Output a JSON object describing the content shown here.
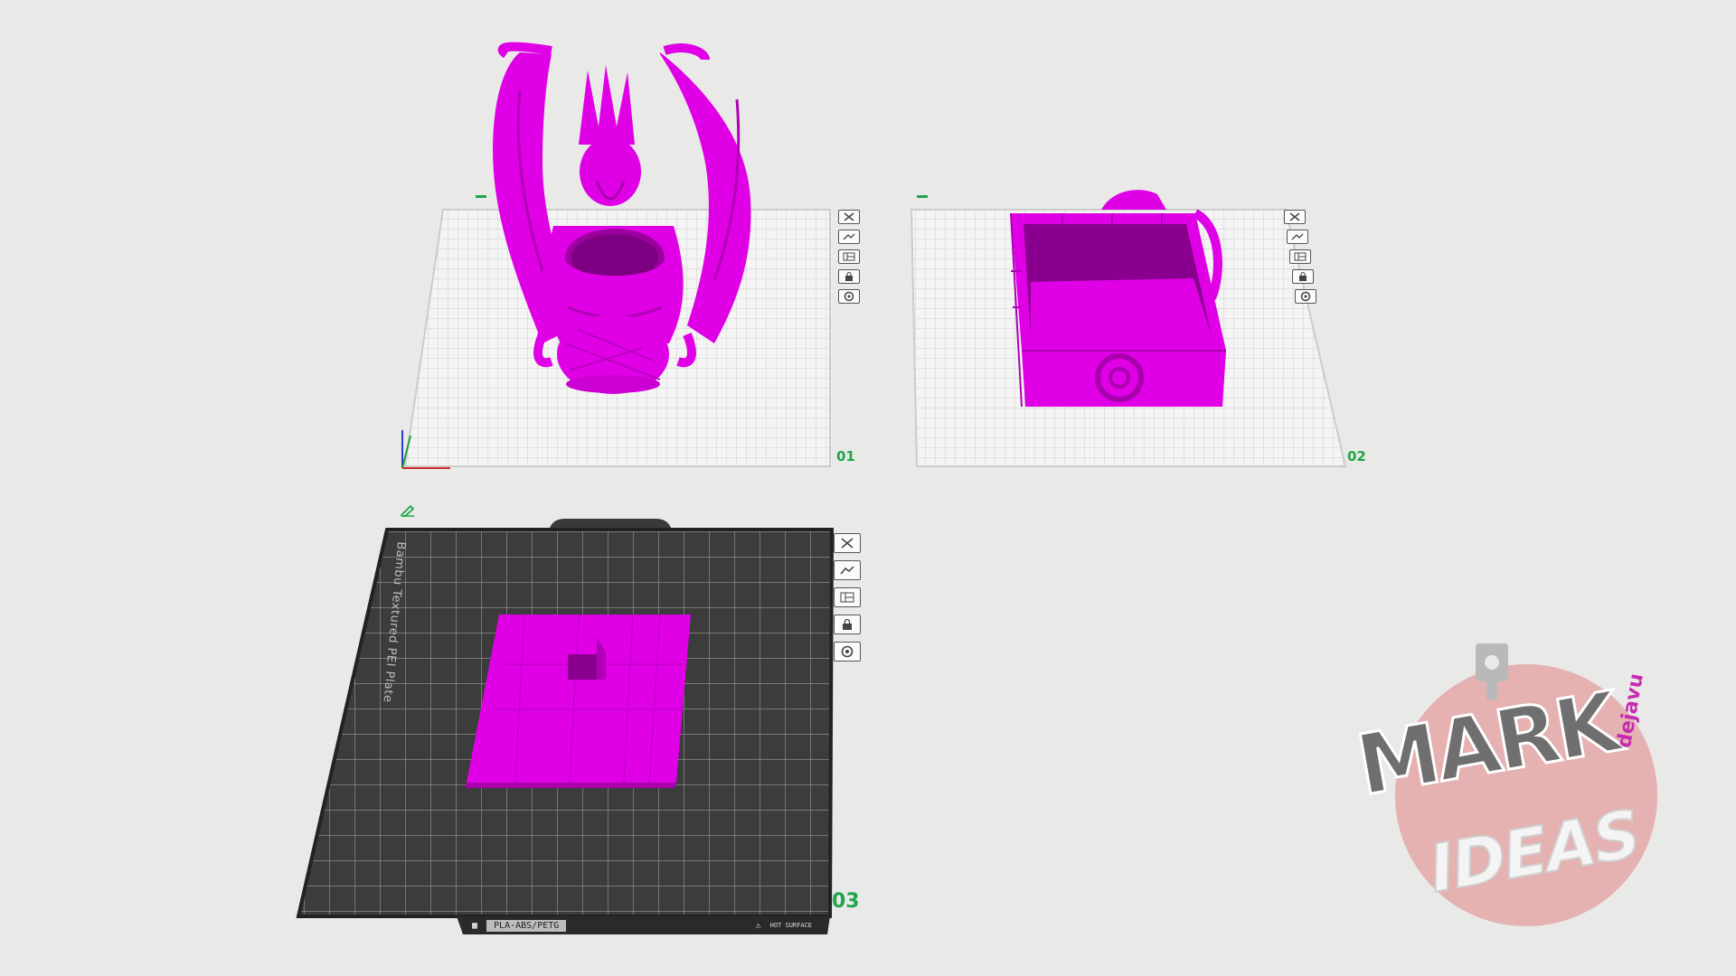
{
  "plates": [
    {
      "number": "01",
      "object": "dragon-cup",
      "active": false
    },
    {
      "number": "02",
      "object": "storage-box",
      "active": false
    },
    {
      "number": "03",
      "object": "box-lid",
      "active": true,
      "bed_label": "Bambu Textured PEI Plate",
      "footer": {
        "material": "PLA-ABS/PETG",
        "warning": "HOT SURFACE"
      }
    }
  ],
  "plate_toolbar": [
    {
      "name": "close-plate-icon"
    },
    {
      "name": "auto-orient-icon"
    },
    {
      "name": "arrange-icon"
    },
    {
      "name": "lock-icon"
    },
    {
      "name": "settings-icon"
    }
  ],
  "watermark": {
    "line1": "MARK",
    "line2": "IDEAS",
    "tag": "dejavu"
  },
  "colors": {
    "background": "#e9e9e8",
    "grid_light": "#d6d6d6",
    "bed_dark": "#3c3c3c",
    "model": "#e000e6",
    "model_shadow": "#a800ad",
    "plate_number": "#1fa64a",
    "watermark_circle": "#e4a7a7",
    "watermark_text": "#6f6f6f"
  }
}
